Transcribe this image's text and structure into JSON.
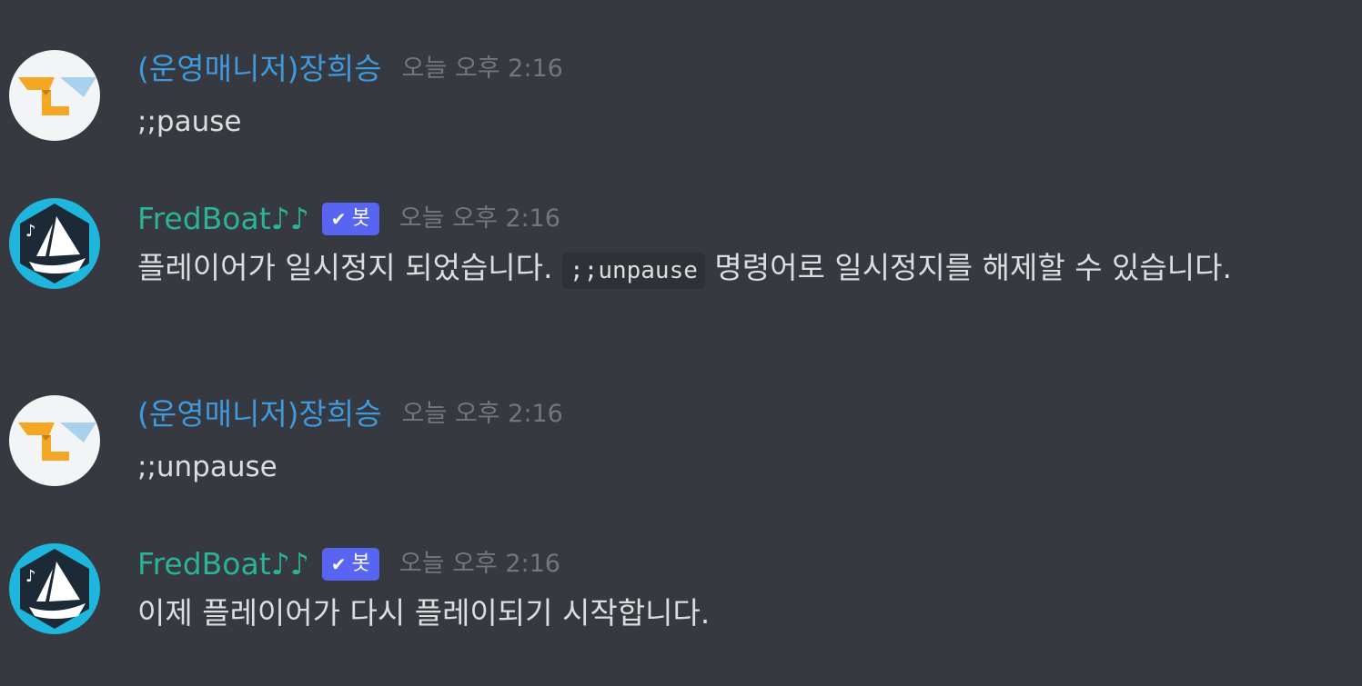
{
  "messages": [
    {
      "author": "(운영매니저)장희승",
      "timestamp": "오늘 오후 2:16",
      "content": ";;pause"
    },
    {
      "author": "FredBoat♪♪",
      "bot_tag": "봇",
      "timestamp": "오늘 오후 2:16",
      "content_before": "플레이어가 일시정지 되었습니다.",
      "code": ";;unpause",
      "content_after": "명령어로 일시정지를 해제할 수 있습니다."
    },
    {
      "author": "(운영매니저)장희승",
      "timestamp": "오늘 오후 2:16",
      "content": ";;unpause"
    },
    {
      "author": "FredBoat♪♪",
      "bot_tag": "봇",
      "timestamp": "오늘 오후 2:16",
      "content": "이제 플레이어가 다시 플레이되기 시작합니다."
    }
  ],
  "icons": {
    "manager_avatar": "letter-l-envelope-icon",
    "bot_avatar": "sailboat-music-icon",
    "verified": "checkmark-icon"
  },
  "colors": {
    "background": "#36393f",
    "manager_name": "#3f99dc",
    "bot_name": "#2cb395",
    "bot_tag": "#5865f2",
    "timestamp": "#72767d",
    "message_text": "#dcddde"
  }
}
